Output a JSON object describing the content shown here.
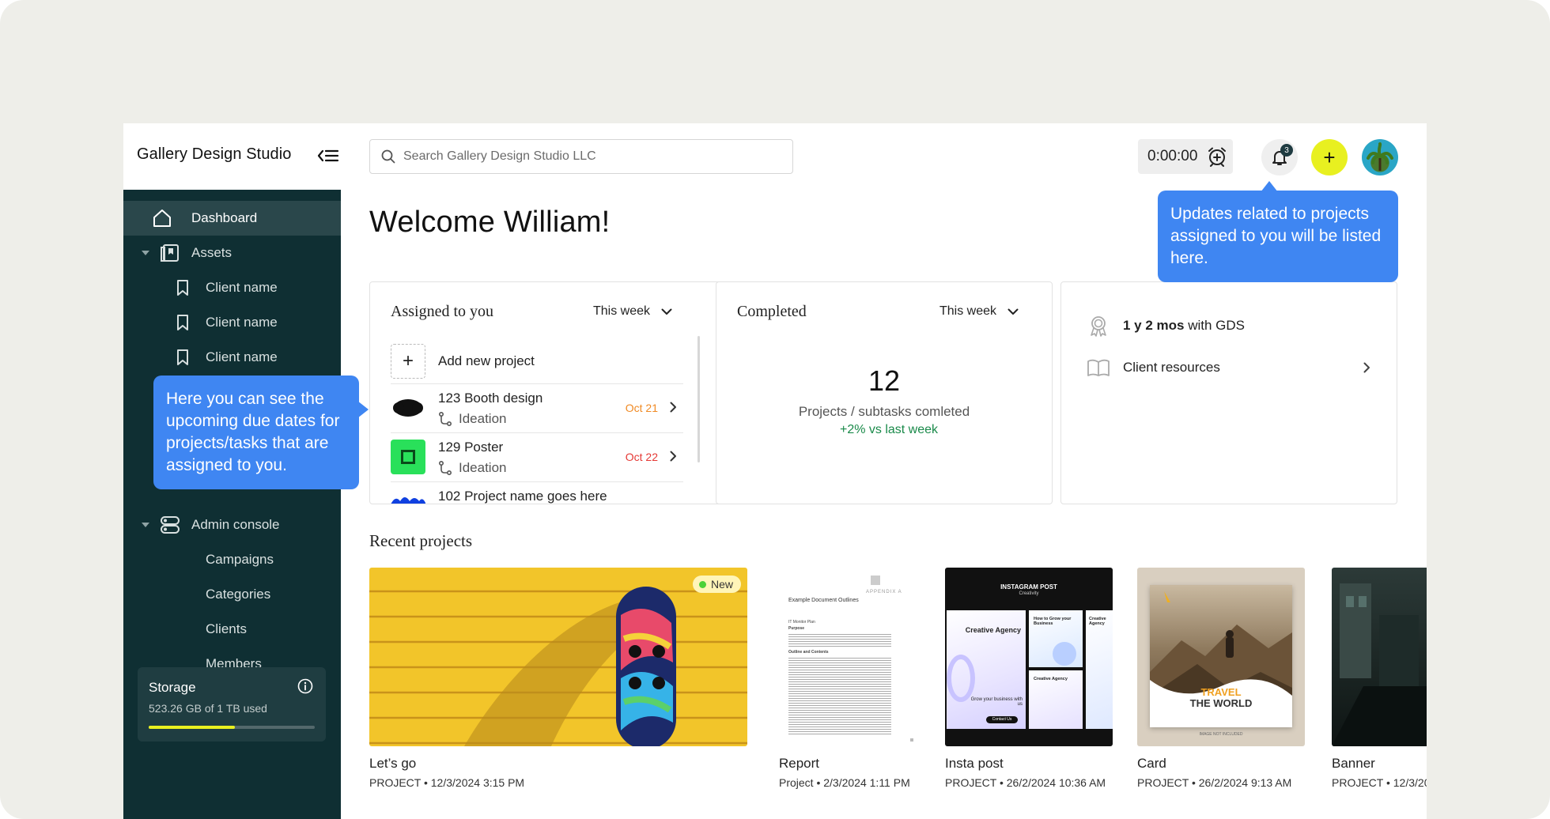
{
  "app": {
    "brand": "Gallery Design Studio",
    "search_placeholder": "Search Gallery Design Studio LLC",
    "timer": "0:00:00",
    "notification_count": "3"
  },
  "sidebar": {
    "items": [
      {
        "label": "Dashboard",
        "icon": "home-icon"
      },
      {
        "label": "Assets",
        "icon": "assets-icon"
      },
      {
        "label": "Client name",
        "icon": "bookmark-icon"
      },
      {
        "label": "Client name",
        "icon": "bookmark-icon"
      },
      {
        "label": "Client name",
        "icon": "bookmark-icon"
      },
      {
        "label": "Admin console",
        "icon": "admin-icon"
      },
      {
        "label": "Campaigns"
      },
      {
        "label": "Categories"
      },
      {
        "label": "Clients"
      },
      {
        "label": "Members"
      }
    ],
    "storage": {
      "title": "Storage",
      "used": "523.26 GB of 1 TB used",
      "fraction": 0.52
    }
  },
  "main": {
    "welcome": "Welcome William!",
    "assigned": {
      "title": "Assigned to you",
      "period": "This week",
      "add_label": "Add new project",
      "rows": [
        {
          "name": "123 Booth design",
          "stage": "Ideation",
          "date": "Oct 21",
          "date_color": "#f08a24"
        },
        {
          "name": "129 Poster",
          "stage": "Ideation",
          "date": "Oct 22",
          "date_color": "#e53935"
        },
        {
          "name": "102 Project name goes here",
          "stage": "",
          "date": "",
          "date_color": "#222222"
        }
      ]
    },
    "completed": {
      "title": "Completed",
      "period": "This week",
      "count": "12",
      "label": "Projects / subtasks comleted",
      "delta": "+2% vs last week"
    },
    "resources": {
      "tenure_bold": "1 y 2 mos",
      "tenure_rest": " with GDS",
      "client_resources": "Client resources"
    },
    "recent_title": "Recent projects",
    "recent": [
      {
        "title": "Let’s go",
        "meta": "PROJECT • 12/3/2024 3:15 PM",
        "badge": "New"
      },
      {
        "title": "Report",
        "meta": "Project • 2/3/2024 1:11 PM"
      },
      {
        "title": "Insta post",
        "meta": "PROJECT • 26/2/2024 10:36 AM"
      },
      {
        "title": "Card",
        "meta": "PROJECT • 26/2/2024 9:13 AM"
      },
      {
        "title": "Banner",
        "meta": "PROJECT • 12/3/20"
      }
    ],
    "doc": {
      "appendix": "APPENDIX A",
      "heading": "Example Document Outlines",
      "l1": "IT Monitor Plan",
      "l2": "Purpose",
      "l3": "Outline and Contents"
    },
    "insta": {
      "header": "INSTAGRAM POST",
      "sub": "Creativity",
      "left": "Creative Agency",
      "mid1": "How to Grow your Business",
      "mid2": "Creative Agency",
      "right1": "Creative Agency",
      "bottom": "Grow your business with us",
      "cta": "Contact Us"
    },
    "card_design": {
      "line1": "TRAVEL",
      "line2": "THE WORLD",
      "footer": "IMAGE NOT INCLUDED"
    }
  },
  "tooltips": {
    "notifications": "Updates related to projects assigned to you will be listed here.",
    "due_dates": "Here you can see the upcoming due dates for projects/tasks that are assigned to you."
  },
  "colors": {
    "sidebar": "#0f2f33",
    "accent_yellow": "#e8f020",
    "tooltip_blue": "#3f86f2",
    "positive_green": "#1a8a4a"
  }
}
